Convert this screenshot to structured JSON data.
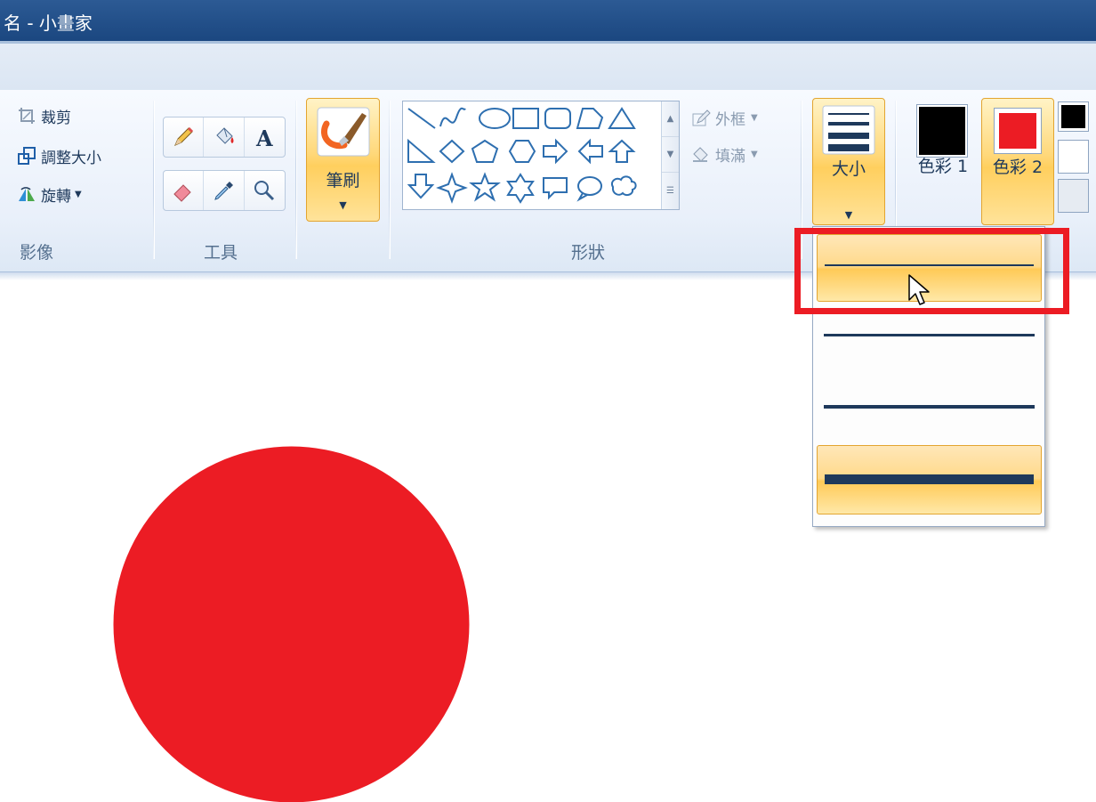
{
  "window": {
    "title": "名 - 小畫家"
  },
  "ribbon": {
    "image_group": {
      "label": "影像",
      "crop": "裁剪",
      "resize": "調整大小",
      "rotate": "旋轉"
    },
    "tools_group": {
      "label": "工具"
    },
    "brushes": {
      "label": "筆刷"
    },
    "shapes_group": {
      "label": "形狀",
      "outline": "外框",
      "fill": "填滿"
    },
    "size": {
      "label": "大小"
    },
    "colors": {
      "color1_label": "色彩 1",
      "color2_label": "色彩 2",
      "color1": "#000000",
      "color2": "#ec1c24",
      "palette": [
        "#000000",
        "#ffffff",
        "#e6ebf2"
      ]
    }
  },
  "size_dropdown": {
    "options": [
      {
        "name": "1px",
        "hovered": true
      },
      {
        "name": "3px",
        "hovered": false
      },
      {
        "name": "5px",
        "hovered": false
      },
      {
        "name": "8px",
        "selected": true
      }
    ]
  },
  "canvas": {
    "shape": "circle",
    "fill_color": "#ec1c24"
  },
  "annotation": {
    "highlight_color": "#ec1c24"
  }
}
